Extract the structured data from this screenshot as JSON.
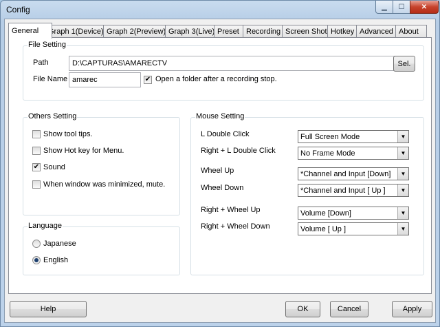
{
  "window": {
    "title": "Config"
  },
  "tabs": [
    {
      "label": "General"
    },
    {
      "label": "Graph 1(Device)"
    },
    {
      "label": "Graph 2(Preview)"
    },
    {
      "label": "Graph 3(Live)"
    },
    {
      "label": "Preset"
    },
    {
      "label": "Recording"
    },
    {
      "label": "Screen Shot"
    },
    {
      "label": "Hotkey"
    },
    {
      "label": "Advanced"
    },
    {
      "label": "About"
    }
  ],
  "file_setting": {
    "title": "File Setting",
    "path_label": "Path",
    "path_value": "D:\\CAPTURAS\\AMARECTV",
    "select_button": "Sel.",
    "filename_label": "File Name",
    "filename_value": "amarec",
    "open_folder_label": "Open a folder after a recording stop.",
    "open_folder_checked": true
  },
  "others_setting": {
    "title": "Others Setting",
    "items": [
      {
        "label": "Show tool tips.",
        "checked": false
      },
      {
        "label": "Show Hot key for Menu.",
        "checked": false
      },
      {
        "label": "Sound",
        "checked": true
      },
      {
        "label": "When window was minimized, mute.",
        "checked": false
      }
    ]
  },
  "language": {
    "title": "Language",
    "options": [
      {
        "label": "Japanese",
        "selected": false
      },
      {
        "label": "English",
        "selected": true
      }
    ]
  },
  "mouse_setting": {
    "title": "Mouse Setting",
    "rows": [
      {
        "label": "L Double Click",
        "value": "Full Screen Mode"
      },
      {
        "label": "Right + L Double Click",
        "value": "No Frame Mode"
      },
      {
        "label": "Wheel Up",
        "value": "*Channel and Input [Down]"
      },
      {
        "label": "Wheel Down",
        "value": "*Channel and Input [ Up ]"
      },
      {
        "label": "Right + Wheel Up",
        "value": "Volume [Down]"
      },
      {
        "label": "Right + Wheel Down",
        "value": "Volume [ Up ]"
      }
    ]
  },
  "buttons": {
    "help": "Help",
    "ok": "OK",
    "cancel": "Cancel",
    "apply": "Apply"
  },
  "glyphs": {
    "check": "✔",
    "arrow": "▼",
    "minimize": "▁",
    "maximize": "☐",
    "close": "✕"
  }
}
